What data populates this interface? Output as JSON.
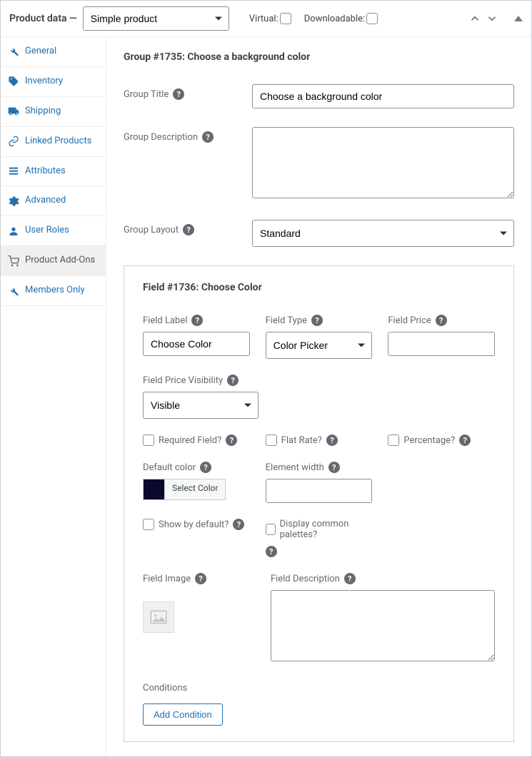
{
  "header": {
    "title": "Product data —",
    "product_type": "Simple product",
    "virtual_label": "Virtual:",
    "downloadable_label": "Downloadable:"
  },
  "sidebar": {
    "items": [
      {
        "label": "General",
        "icon": "wrench"
      },
      {
        "label": "Inventory",
        "icon": "tag"
      },
      {
        "label": "Shipping",
        "icon": "truck"
      },
      {
        "label": "Linked Products",
        "icon": "link"
      },
      {
        "label": "Attributes",
        "icon": "list"
      },
      {
        "label": "Advanced",
        "icon": "gear"
      },
      {
        "label": "User Roles",
        "icon": "user"
      },
      {
        "label": "Product Add-Ons",
        "icon": "cart"
      },
      {
        "label": "Members Only",
        "icon": "wrench"
      }
    ]
  },
  "group": {
    "heading": "Group #1735: Choose a background color",
    "labels": {
      "title": "Group Title",
      "description": "Group Description",
      "layout": "Group Layout"
    },
    "values": {
      "title": "Choose a background color",
      "description": "",
      "layout": "Standard"
    }
  },
  "field": {
    "heading": "Field #1736: Choose Color",
    "labels": {
      "field_label": "Field Label",
      "field_type": "Field Type",
      "field_price": "Field Price",
      "price_visibility": "Field Price Visibility",
      "required": "Required Field?",
      "flat_rate": "Flat Rate?",
      "percentage": "Percentage?",
      "default_color": "Default color",
      "element_width": "Element width",
      "show_default": "Show by default?",
      "display_palettes": "Display common palettes?",
      "field_image": "Field Image",
      "field_description": "Field Description",
      "conditions": "Conditions",
      "add_condition": "Add Condition",
      "select_color": "Select Color"
    },
    "values": {
      "field_label": "Choose Color",
      "field_type": "Color Picker",
      "field_price": "",
      "price_visibility": "Visible",
      "element_width": "",
      "field_description": ""
    }
  }
}
